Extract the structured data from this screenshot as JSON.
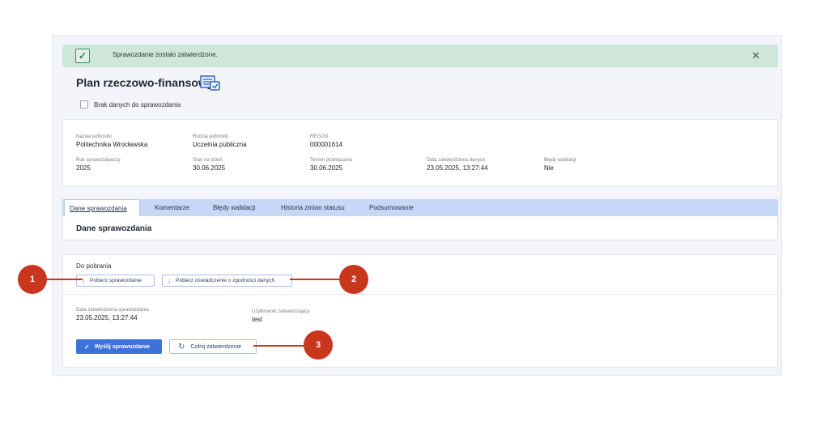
{
  "banner": {
    "message": "Sprawozdanie zostało zatwierdzone.",
    "check_icon": "check-icon",
    "close_icon": "close-icon",
    "colors": {
      "background": "#cfe6da",
      "accent": "#3d8f63"
    }
  },
  "header": {
    "title": "Plan rzeczowo-finansowy",
    "title_icon": "report-list-icon"
  },
  "no_data": {
    "label": "Brak danych do sprawozdania"
  },
  "info": {
    "fields": [
      {
        "label": "Nazwa jednostki",
        "value": "Politechnika Wrocławska"
      },
      {
        "label": "Rodzaj jednostki",
        "value": "Uczelnia publiczna"
      },
      {
        "label": "REGON",
        "value": "000001614"
      },
      {
        "label": "Rok sprawozdawczy",
        "value": "2025"
      },
      {
        "label": "Stan na dzień",
        "value": "30.06.2025"
      },
      {
        "label": "Termin przekazania",
        "value": "30.06.2025"
      },
      {
        "label": "Data zatwierdzenia danych",
        "value": "23.05.2025, 13:27:44"
      },
      {
        "label": "Błędy walidacji",
        "value": "Nie"
      }
    ]
  },
  "tabs": [
    {
      "label": "Dane sprawozdania",
      "active": true
    },
    {
      "label": "Komentarze"
    },
    {
      "label": "Błędy walidacji"
    },
    {
      "label": "Historia zmian statusu"
    },
    {
      "label": "Podsumowanie"
    }
  ],
  "section": {
    "title": "Dane sprawozdania"
  },
  "downloads": {
    "caption": "Do pobrania",
    "download_report": "Pobierz sprawozdanie",
    "download_statement": "Pobierz oświadczenie o zgodności danych",
    "download_icon": "arrow-down-icon"
  },
  "approval": {
    "date_label": "Data zatwierdzenia sprawozdania",
    "date_value": "23.05.2025, 13:27:44",
    "user_label": "Użytkownik zatwierdzający",
    "user_value": "test"
  },
  "actions": {
    "send": "Wyślij sprawozdanie",
    "send_icon": "check-icon",
    "revert": "Cofnij zatwierdzenie",
    "revert_icon": "undo-icon",
    "colors": {
      "primary": "#3d72d9"
    }
  },
  "callouts": {
    "items": [
      "1",
      "2",
      "3"
    ],
    "color": "#c9361e"
  }
}
